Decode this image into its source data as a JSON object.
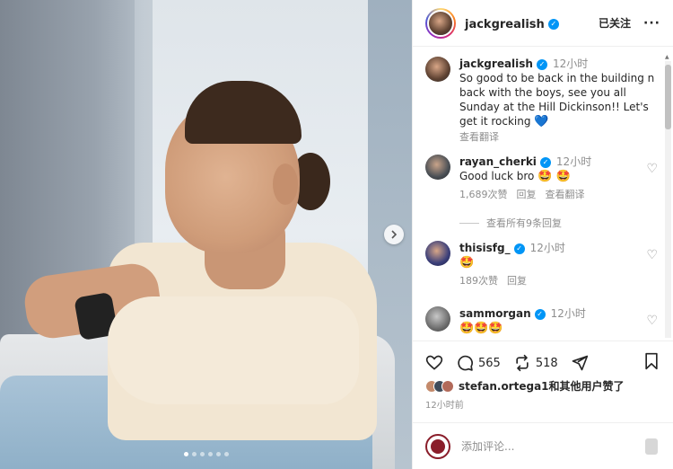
{
  "post": {
    "username": "jackgrealish",
    "follow_label": "已关注",
    "more_label": "···"
  },
  "caption": {
    "username": "jackgrealish",
    "time": "12小时",
    "text": "So good to be back in the building n back with the boys, see you all Sunday at the Hill Dickinson!! Let's get it rocking",
    "emoji": "💙",
    "see_translation": "查看翻译"
  },
  "comments": [
    {
      "username": "rayan_cherki",
      "time": "12小时",
      "text": "Good luck bro",
      "emoji": "🤩 🤩",
      "likes": "1,689次赞",
      "reply_label": "回复",
      "see_translation": "查看翻译",
      "view_replies": "查看所有9条回复"
    },
    {
      "username": "thisisfg_",
      "time": "12小时",
      "text": "",
      "emoji": "🤩",
      "likes": "189次赞",
      "reply_label": "回复"
    },
    {
      "username": "sammorgan",
      "time": "12小时",
      "emoji": "🤩🤩🤩"
    }
  ],
  "actions": {
    "comment_count": "565",
    "repost_count": "518"
  },
  "liked_by": {
    "user": "stefan.ortega1",
    "suffix": "和其他用户赞了"
  },
  "posted_ago": "12小时前",
  "comment_input": {
    "placeholder": "添加评论..."
  },
  "carousel": {
    "slide_count": 6,
    "active_index": 0
  },
  "colors": {
    "verified": "#0095f6",
    "text": "#262626",
    "muted": "#8e8e8e"
  }
}
